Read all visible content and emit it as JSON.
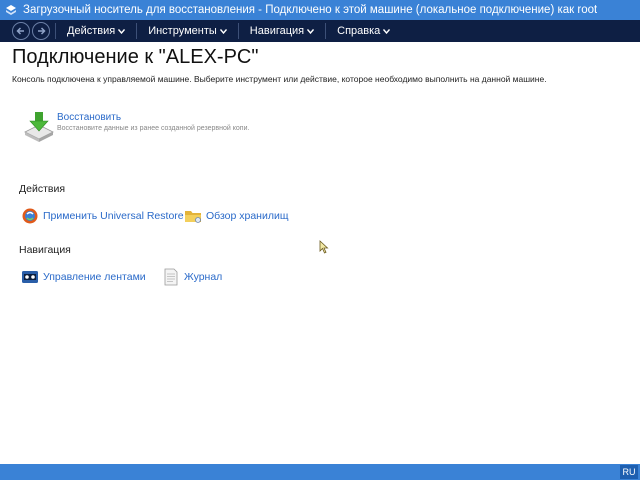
{
  "window": {
    "title": "Загрузочный носитель для восстановления - Подключено к этой машине (локальное подключение) как root"
  },
  "menu": {
    "items": [
      {
        "label": "Действия"
      },
      {
        "label": "Инструменты"
      },
      {
        "label": "Навигация"
      },
      {
        "label": "Справка"
      }
    ]
  },
  "page": {
    "title": "Подключение к \"ALEX-PC\"",
    "description": "Консоль подключена к управляемой машине. Выберите инструмент или действие, которое необходимо выполнить на данной машине."
  },
  "restore": {
    "label": "Восстановить",
    "description": "Восстановите данные из ранее созданной резервной копи."
  },
  "actions": {
    "heading": "Действия",
    "universal_restore": "Применить Universal Restore",
    "browse_vaults": "Обзор хранилищ"
  },
  "navigation": {
    "heading": "Навигация",
    "tape_management": "Управление лентами",
    "log": "Журнал"
  },
  "taskbar": {
    "language": "RU"
  },
  "colors": {
    "titlebar": "#3a82d6",
    "menubar": "#0e1f44",
    "link": "#2a6ac9"
  },
  "icons": [
    "app-icon",
    "back-arrow-icon",
    "forward-arrow-icon",
    "restore-icon",
    "universal-restore-icon",
    "folder-icon",
    "tape-icon",
    "document-icon",
    "mouse-cursor-icon"
  ]
}
